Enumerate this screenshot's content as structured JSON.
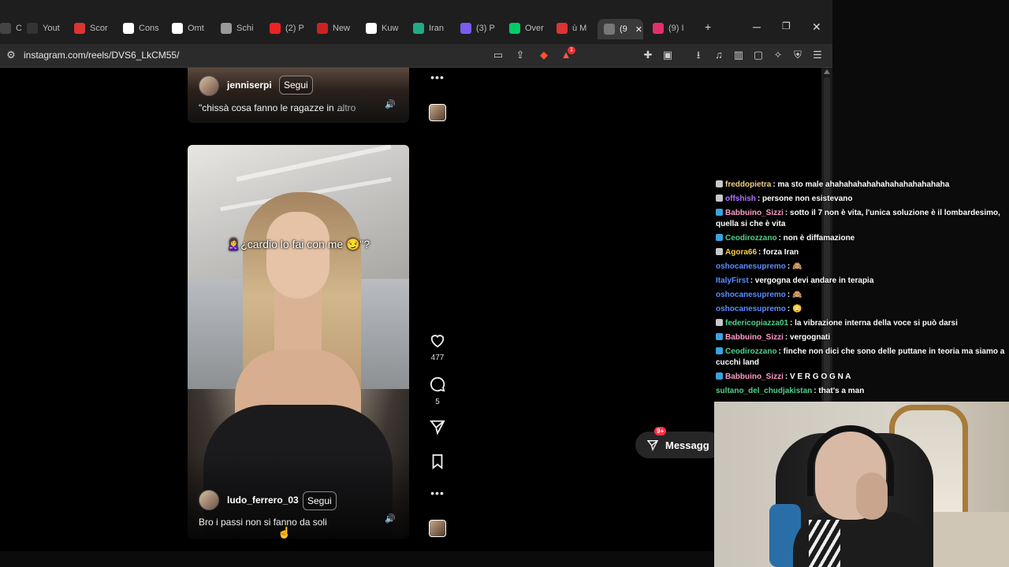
{
  "browser": {
    "tabs": [
      {
        "label": "C",
        "color": "#444"
      },
      {
        "label": "Yout",
        "color": "#333"
      },
      {
        "label": "Scor",
        "color": "#d33"
      },
      {
        "label": "Cons",
        "color": "#fff"
      },
      {
        "label": "Omt",
        "color": "#fff"
      },
      {
        "label": "Schi",
        "color": "#999"
      },
      {
        "label": "(2) P",
        "color": "#e22"
      },
      {
        "label": "New",
        "color": "#c22"
      },
      {
        "label": "Kuw",
        "color": "#fff"
      },
      {
        "label": "Iran",
        "color": "#2a8"
      },
      {
        "label": "(3) P",
        "color": "#7a5cf0"
      },
      {
        "label": "Over",
        "color": "#0c6"
      },
      {
        "label": "ù M",
        "color": "#d33"
      },
      {
        "label": "(9",
        "color": "#777"
      },
      {
        "label": "(9) I",
        "color": "#e1306c"
      }
    ],
    "new_tab": "+",
    "minimize": "─",
    "restore": "❐",
    "close": "✕",
    "url": "instagram.com/reels/DVS6_LkCM55/",
    "notif_count": "1"
  },
  "reel_top": {
    "username": "jenniserpi",
    "follow": "Segui",
    "caption": "\"chissà cosa fanno le ragazze in ...",
    "more": "altro"
  },
  "reel_main": {
    "overlay_text": "🙎‍♀️¿cardio lo fai con me 😏\"?",
    "username": "ludo_ferrero_03",
    "follow": "Segui",
    "caption": "Bro i passi non si fanno da soli"
  },
  "actions": {
    "likes": "477",
    "comments": "5"
  },
  "messages": {
    "label": "Messagg",
    "badge": "9+"
  },
  "chat": [
    {
      "user": "freddopietra",
      "color": "#f0d080",
      "text": ": ma sto male ahahahahahahahahahahahahaha",
      "icon": "#c8c8c8"
    },
    {
      "user": "offshish",
      "color": "#b070ff",
      "text": ": persone non esistevano",
      "icon": "#c8c8c8"
    },
    {
      "user": "Babbuino_Sizzi",
      "color": "#ff9ac8",
      "text": ": sotto il 7 non è vita, l'unica soluzione è il lombardesimo, quella si che è vita",
      "icon": "#39a3e0"
    },
    {
      "user": "Ceodirozzano",
      "color": "#4fd08a",
      "text": ": non è diffamazione",
      "icon": "#39a3e0"
    },
    {
      "user": "Agora66",
      "color": "#f5d040",
      "text": ": forza Iran",
      "icon": "#c8c8c8"
    },
    {
      "user": "oshocanesupremo",
      "color": "#5a8cff",
      "text": ": 🙈",
      "icon": ""
    },
    {
      "user": "ItalyFirst",
      "color": "#5a8cff",
      "text": ": vergogna devi andare in terapia",
      "icon": ""
    },
    {
      "user": "oshocanesupremo",
      "color": "#5a8cff",
      "text": ": 🙈",
      "icon": ""
    },
    {
      "user": "oshocanesupremo",
      "color": "#5a8cff",
      "text": ": 😳",
      "icon": ""
    },
    {
      "user": "federicopiazza01",
      "color": "#4fd08a",
      "text": ": la vibrazione interna della voce si può darsi",
      "icon": "#c8c8c8"
    },
    {
      "user": "Babbuino_Sizzi",
      "color": "#ff9ac8",
      "text": ": vergognati",
      "icon": "#39a3e0"
    },
    {
      "user": "Ceodirozzano",
      "color": "#4fd08a",
      "text": ": finche non dici che sono delle puttane in teoria ma siamo a cucchi land",
      "icon": "#39a3e0"
    },
    {
      "user": "Babbuino_Sizzi",
      "color": "#ff9ac8",
      "text": ": V E R G O G N A",
      "icon": "#39a3e0"
    },
    {
      "user": "sultano_del_chudjakistan",
      "color": "#4fd08a",
      "text": ": that's a man",
      "icon": ""
    }
  ]
}
